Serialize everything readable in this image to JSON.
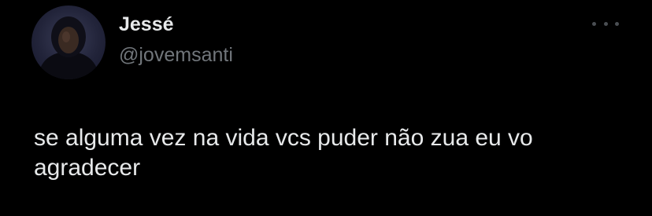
{
  "tweet": {
    "author": {
      "display_name": "Jessé",
      "handle": "@jovemsanti",
      "avatar_icon": "user-avatar"
    },
    "more_icon": "more-options-icon",
    "text": "se alguma vez na vida vcs puder não zua eu vo agradecer"
  },
  "colors": {
    "background": "#000000",
    "text_primary": "#e7e9ea",
    "text_secondary": "#71767b"
  }
}
